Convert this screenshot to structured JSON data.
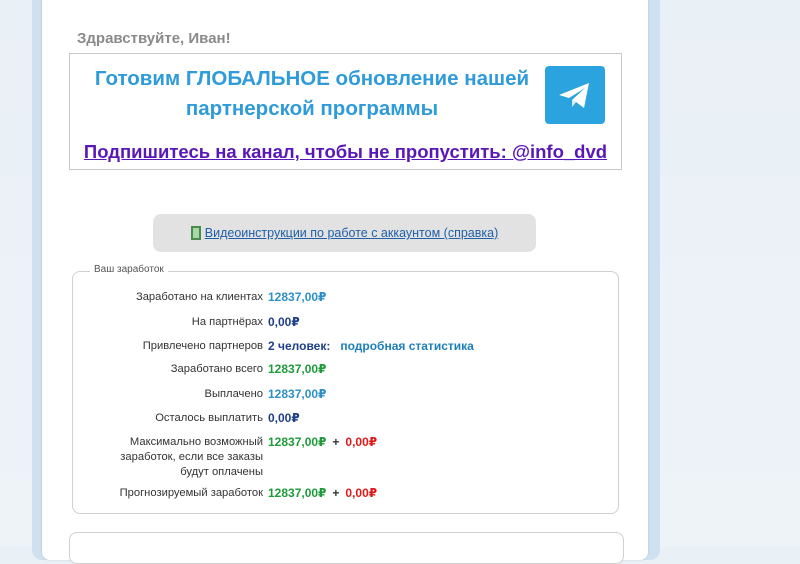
{
  "greeting": "Здравствуйте, Иван!",
  "promo": {
    "title_line1": "Готовим ГЛОБАЛЬНОЕ обновление нашей",
    "title_line2": "партнерской программы",
    "link": "Подпишитесь на канал, чтобы не пропустить: @info_dvd",
    "icon": "telegram-icon"
  },
  "video": {
    "icon": "film-icon",
    "link": "Видеоинструкции по работе с аккаунтом (справка)"
  },
  "earnings": {
    "legend": "Ваш заработок",
    "rows": {
      "clients": {
        "label": "Заработано на клиентах",
        "value": "12837,00₽"
      },
      "partners": {
        "label": "На партнёрах",
        "value": "0,00₽"
      },
      "referred": {
        "label": "Привлечено партнеров",
        "value": "2 человек:",
        "link": "подробная статистика"
      },
      "total": {
        "label": "Заработано всего",
        "value": "12837,00₽"
      },
      "paid": {
        "label": "Выплачено",
        "value": "12837,00₽"
      },
      "remaining": {
        "label": "Осталось выплатить",
        "value": "0,00₽"
      },
      "max": {
        "label": "Максимально возможный заработок, если все заказы будут оплачены",
        "value1": "12837,00₽",
        "plus": "+",
        "value2": "0,00₽"
      },
      "forecast": {
        "label": "Прогнозируемый заработок",
        "value1": "12837,00₽",
        "plus": "+",
        "value2": "0,00₽"
      }
    }
  },
  "colors": {
    "title_blue": "#2f9bd8",
    "link_purple": "#5a17b8",
    "value_green": "#1f9a3a",
    "value_red": "#e01818",
    "telegram_blue": "#2aa3df"
  }
}
